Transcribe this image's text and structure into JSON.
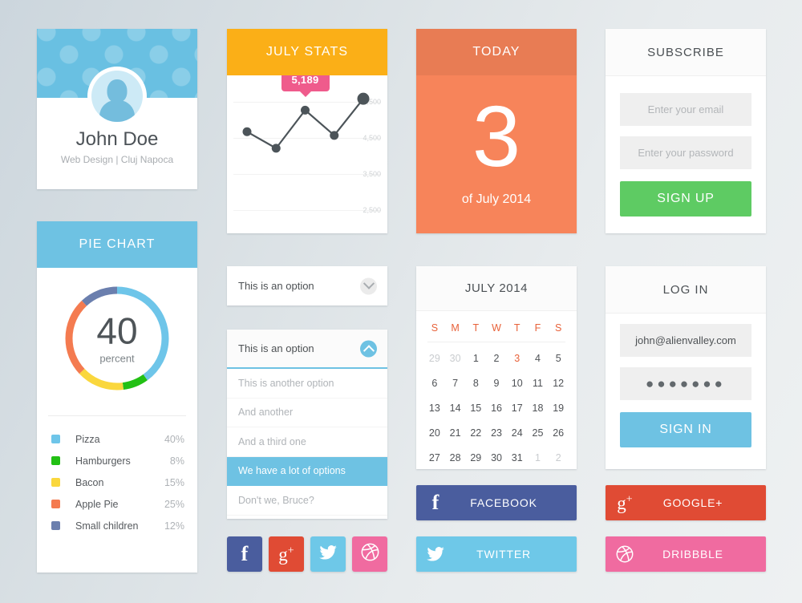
{
  "profile": {
    "name": "John Doe",
    "subtitle": "Web Design | Cluj Napoca",
    "avatar_icon": "user-avatar-icon",
    "cover_color": "#69c0e2"
  },
  "pie": {
    "header": "PIE CHART",
    "header_color": "#6ec2e3",
    "center_value": "40",
    "center_unit": "percent",
    "legend": [
      {
        "label": "Pizza",
        "pct": "40%",
        "color": "#6ec5e9"
      },
      {
        "label": "Hamburgers",
        "pct": "8%",
        "color": "#22c014"
      },
      {
        "label": "Bacon",
        "pct": "15%",
        "color": "#fad73d"
      },
      {
        "label": "Apple Pie",
        "pct": "25%",
        "color": "#f47b50"
      },
      {
        "label": "Small children",
        "pct": "12%",
        "color": "#6b7fae"
      }
    ]
  },
  "stats": {
    "header": "JULY STATS",
    "header_color": "#fbaf17",
    "tooltip": "5,189"
  },
  "chart_data": [
    {
      "type": "pie",
      "title": "PIE CHART",
      "labels": [
        "Pizza",
        "Hamburgers",
        "Bacon",
        "Apple Pie",
        "Small children"
      ],
      "values": [
        40,
        8,
        15,
        25,
        12
      ],
      "colors": [
        "#6ec5e9",
        "#22c014",
        "#fad73d",
        "#f47b50",
        "#6b7fae"
      ],
      "center_label": "40 percent",
      "legend": "bottom",
      "donut": true
    },
    {
      "type": "line",
      "title": "JULY STATS",
      "x": [
        1,
        2,
        3,
        4,
        5
      ],
      "values": [
        4600,
        4150,
        5189,
        4500,
        5500
      ],
      "ytick_labels": [
        "5,500",
        "4,500",
        "3,500",
        "2,500"
      ],
      "yticks": [
        5500,
        4500,
        3500,
        2500
      ],
      "ylim": [
        2200,
        5700
      ],
      "annotations": [
        {
          "x": 3,
          "y": 5189,
          "text": "5,189"
        }
      ],
      "grid": true,
      "legend": "none",
      "xlabel": "",
      "ylabel": ""
    }
  ],
  "dropdown_closed": {
    "selected": "This is an option",
    "caret_icon": "chevron-down-icon"
  },
  "dropdown_open": {
    "selected": "This is an option",
    "caret_icon": "chevron-up-icon",
    "options": [
      {
        "label": "This is another option",
        "selected": false
      },
      {
        "label": "And another",
        "selected": false
      },
      {
        "label": "And a third one",
        "selected": false
      },
      {
        "label": "We have a lot of options",
        "selected": true
      },
      {
        "label": "Don't we, Bruce?",
        "selected": false
      }
    ]
  },
  "today": {
    "header": "TODAY",
    "day": "3",
    "subtitle": "of July 2014",
    "bg_color": "#f7845a"
  },
  "calendar": {
    "title": "JULY 2014",
    "dow": [
      "S",
      "M",
      "T",
      "W",
      "T",
      "F",
      "S"
    ],
    "weeks": [
      [
        {
          "d": "29",
          "state": "muted"
        },
        {
          "d": "30",
          "state": "muted"
        },
        {
          "d": "1",
          "state": "normal"
        },
        {
          "d": "2",
          "state": "normal"
        },
        {
          "d": "3",
          "state": "today"
        },
        {
          "d": "4",
          "state": "normal"
        },
        {
          "d": "5",
          "state": "normal"
        }
      ],
      [
        {
          "d": "6",
          "state": "normal"
        },
        {
          "d": "7",
          "state": "normal"
        },
        {
          "d": "8",
          "state": "normal"
        },
        {
          "d": "9",
          "state": "normal"
        },
        {
          "d": "10",
          "state": "normal"
        },
        {
          "d": "11",
          "state": "normal"
        },
        {
          "d": "12",
          "state": "normal"
        }
      ],
      [
        {
          "d": "13",
          "state": "normal"
        },
        {
          "d": "14",
          "state": "normal"
        },
        {
          "d": "15",
          "state": "normal"
        },
        {
          "d": "16",
          "state": "normal"
        },
        {
          "d": "17",
          "state": "normal"
        },
        {
          "d": "18",
          "state": "normal"
        },
        {
          "d": "19",
          "state": "normal"
        }
      ],
      [
        {
          "d": "20",
          "state": "normal"
        },
        {
          "d": "21",
          "state": "normal"
        },
        {
          "d": "22",
          "state": "normal"
        },
        {
          "d": "23",
          "state": "normal"
        },
        {
          "d": "24",
          "state": "normal"
        },
        {
          "d": "25",
          "state": "normal"
        },
        {
          "d": "26",
          "state": "normal"
        }
      ],
      [
        {
          "d": "27",
          "state": "normal"
        },
        {
          "d": "28",
          "state": "normal"
        },
        {
          "d": "29",
          "state": "normal"
        },
        {
          "d": "30",
          "state": "normal"
        },
        {
          "d": "31",
          "state": "normal"
        },
        {
          "d": "1",
          "state": "muted"
        },
        {
          "d": "2",
          "state": "muted"
        }
      ]
    ]
  },
  "subscribe": {
    "header": "SUBSCRIBE",
    "email_placeholder": "Enter your email",
    "password_placeholder": "Enter your password",
    "button_label": "SIGN UP",
    "button_color": "#5ecb63"
  },
  "login": {
    "header": "LOG IN",
    "email_value": "john@alienvalley.com",
    "password_value": "●●●●●●●",
    "button_label": "SIGN IN",
    "button_color": "#6ec2e3"
  },
  "social": {
    "facebook": {
      "label": "FACEBOOK",
      "icon": "facebook-icon",
      "color": "#4a5d9e"
    },
    "twitter": {
      "label": "TWITTER",
      "icon": "twitter-icon",
      "color": "#6ec8e8"
    },
    "google": {
      "label": "GOOGLE+",
      "icon": "googleplus-icon",
      "color": "#e04b34"
    },
    "dribbble": {
      "label": "DRIBBBLE",
      "icon": "dribbble-icon",
      "color": "#f06ba0"
    },
    "squares": [
      {
        "icon": "facebook-icon",
        "color": "#4a5d9e"
      },
      {
        "icon": "googleplus-icon",
        "color": "#e04b34"
      },
      {
        "icon": "twitter-icon",
        "color": "#6ec8e8"
      },
      {
        "icon": "dribbble-icon",
        "color": "#f06ba0"
      }
    ]
  }
}
